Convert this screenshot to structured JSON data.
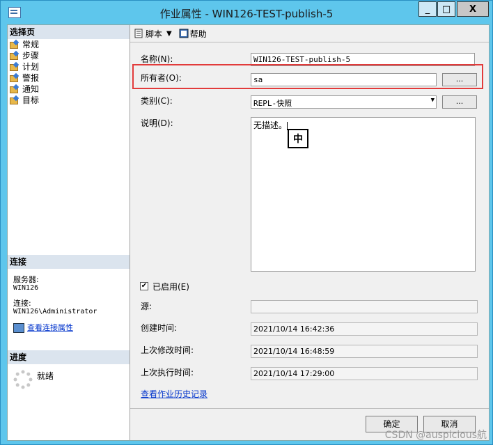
{
  "window": {
    "title": "作业属性 - WIN126-TEST-publish-5",
    "min": "_",
    "max": "□",
    "close": "X"
  },
  "left": {
    "select_page_header": "选择页",
    "pages": [
      "常规",
      "步骤",
      "计划",
      "警报",
      "通知",
      "目标"
    ],
    "connection_header": "连接",
    "server_label": "服务器:",
    "server_value": "WIN126",
    "conn_label": "连接:",
    "conn_value": "WIN126\\Administrator",
    "view_conn_link": "查看连接属性",
    "progress_header": "进度",
    "progress_status": "就绪"
  },
  "toolbar": {
    "script": "脚本",
    "help": "帮助"
  },
  "form": {
    "name_label": "名称(N):",
    "name_value": "WIN126-TEST-publish-5",
    "owner_label": "所有者(O):",
    "owner_value": "sa",
    "category_label": "类别(C):",
    "category_value": "REPL-快照",
    "desc_label": "说明(D):",
    "desc_value": "无描述。",
    "ime_indicator": "中",
    "enabled_label": "已启用(E)",
    "enabled_checked": "✔",
    "source_label": "源:",
    "source_value": "",
    "created_label": "创建时间:",
    "created_value": "2021/10/14 16:42:36",
    "modified_label": "上次修改时间:",
    "modified_value": "2021/10/14 16:48:59",
    "executed_label": "上次执行时间:",
    "executed_value": "2021/10/14 17:29:00",
    "history_link": "查看作业历史记录",
    "browse": "..."
  },
  "footer": {
    "ok": "确定",
    "cancel": "取消"
  },
  "watermark": "CSDN @auspicious航"
}
